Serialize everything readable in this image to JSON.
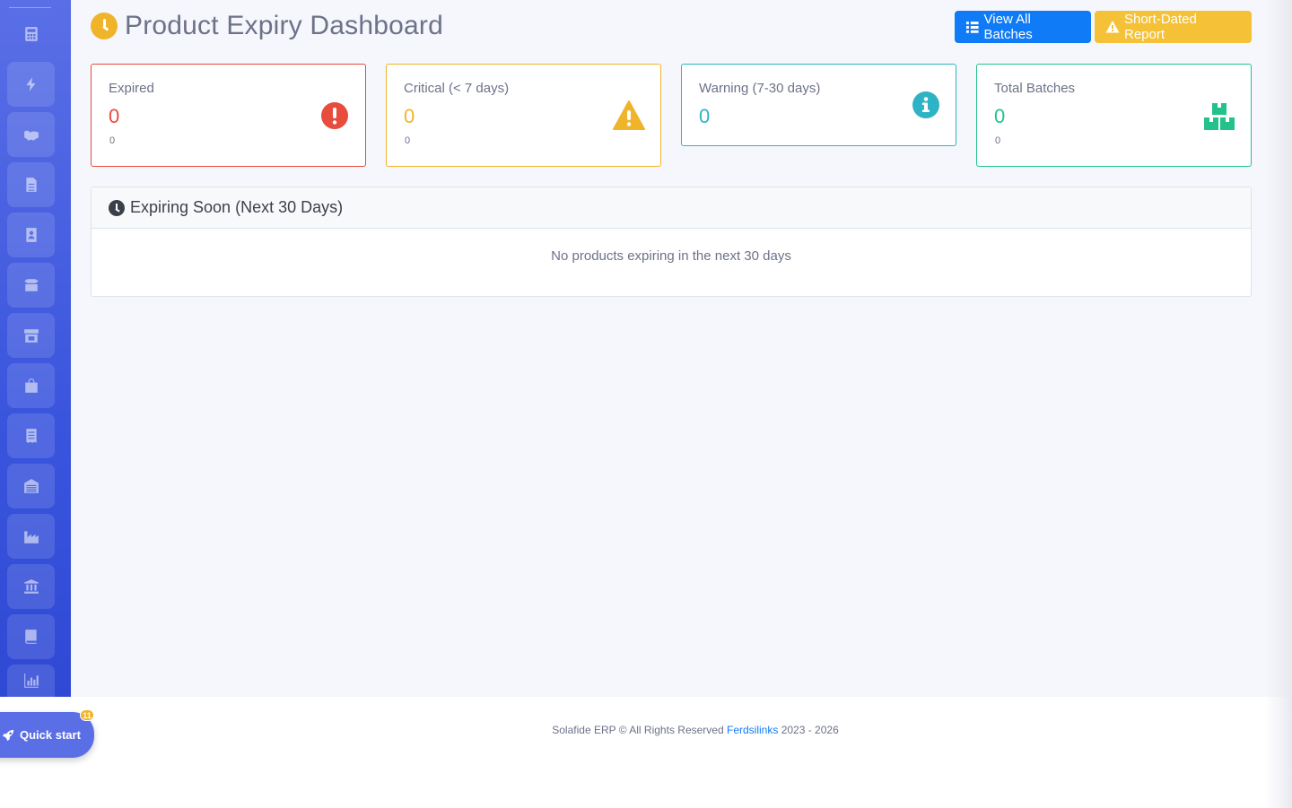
{
  "page": {
    "title": "Product Expiry Dashboard",
    "buttons": {
      "view_all_batches": "View All Batches",
      "short_dated_report": "Short-Dated Report"
    }
  },
  "sidebar": {
    "icons": [
      "calculator-icon",
      "bolt-icon",
      "handshake-icon",
      "file-icon",
      "contact-icon",
      "boxes-icon",
      "store-icon",
      "shopping-bag-icon",
      "receipt-icon",
      "warehouse-icon",
      "industry-icon",
      "bank-icon",
      "book-icon",
      "chart-icon"
    ]
  },
  "cards": {
    "expired": {
      "label": "Expired",
      "value": "0",
      "sub": "0",
      "color": "#e74c3c"
    },
    "critical": {
      "label": "Critical (< 7 days)",
      "value": "0",
      "sub": "0",
      "color": "#f0b42b"
    },
    "warning": {
      "label": "Warning (7-30 days)",
      "value": "0",
      "color": "#2eb3c4"
    },
    "total": {
      "label": "Total Batches",
      "value": "0",
      "sub": "0",
      "color": "#23c28b"
    }
  },
  "expiring_panel": {
    "title": "Expiring Soon (Next 30 Days)",
    "empty_message": "No products expiring in the next 30 days"
  },
  "footer": {
    "prefix": "Solafide ERP © All Rights Reserved",
    "link": "Ferdsilinks",
    "years": "2023 - 2026"
  },
  "quick_start": {
    "label": "Quick start",
    "badge": "11"
  }
}
